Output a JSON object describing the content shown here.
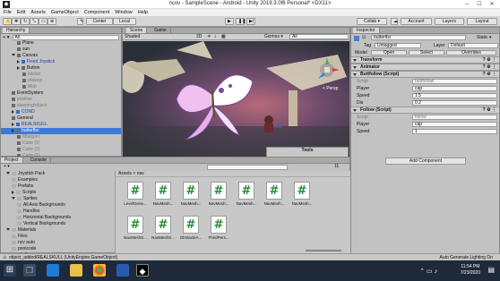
{
  "window": {
    "title": "ncov - SampleScene - Android - Unity 2019.3.0f6 Personal* <DX11>",
    "controls": [
      "─",
      "☐",
      "✕"
    ]
  },
  "menu": [
    "File",
    "Edit",
    "Assets",
    "GameObject",
    "Component",
    "Window",
    "Help"
  ],
  "toolbar": {
    "center": "Center",
    "local": "Local",
    "collab": "Collab ▾",
    "account": "Account",
    "layers": "Layers",
    "layout": "Layout"
  },
  "hierarchy": {
    "title": "Hierarchy",
    "search": "All",
    "items": [
      {
        "label": "Plane",
        "indent": 3,
        "style": "normal"
      },
      {
        "label": "sun",
        "indent": 3,
        "style": "normal"
      },
      {
        "label": "Canvas",
        "indent": 2,
        "style": "normal",
        "arrow": "down"
      },
      {
        "label": "Fixed Joystick",
        "indent": 3,
        "style": "blue",
        "arrow": "right"
      },
      {
        "label": "Button",
        "indent": 3,
        "style": "normal",
        "arrow": "right"
      },
      {
        "label": "blicker",
        "indent": 4,
        "style": "dim"
      },
      {
        "label": "drawcp",
        "indent": 4,
        "style": "dim"
      },
      {
        "label": "Mob",
        "indent": 4,
        "style": "dim"
      },
      {
        "label": "EventSystem",
        "indent": 2,
        "style": "normal"
      },
      {
        "label": "positive",
        "indent": 2,
        "style": "dim"
      },
      {
        "label": "sleeping/object",
        "indent": 2,
        "style": "dim"
      },
      {
        "label": "COND",
        "indent": 2,
        "style": "blue",
        "arrow": "right"
      },
      {
        "label": "General",
        "indent": 2,
        "style": "normal"
      },
      {
        "label": "REALSKULL",
        "indent": 2,
        "style": "blue",
        "arrow": "right"
      },
      {
        "label": "butterfbx",
        "indent": 2,
        "style": "sel",
        "arrow": "right"
      },
      {
        "label": "Mlasport",
        "indent": 3,
        "style": "dim"
      },
      {
        "label": "Cube (1)",
        "indent": 3,
        "style": "dim"
      },
      {
        "label": "Cube (2)",
        "indent": 3,
        "style": "dim"
      },
      {
        "label": "Cube (1)",
        "indent": 3,
        "style": "dim"
      },
      {
        "label": "NU",
        "indent": 2,
        "style": "blue",
        "arrow": "right"
      }
    ]
  },
  "scene": {
    "tabs": [
      "Scene",
      "Game"
    ],
    "shading": "Shaded",
    "mode": "2D",
    "gizmos": "Gizmos ▾",
    "search": "All",
    "persp": "< Persp",
    "tools_title": "Tools",
    "tools_msg": "No custom tools available"
  },
  "inspector": {
    "title": "Inspector",
    "object_name": "butterfbx",
    "static": "Static ▾",
    "tag_label": "Tag",
    "tag": "Untagged",
    "layer_label": "Layer",
    "layer": "Default",
    "model_label": "Model",
    "open": "Open",
    "select": "Select",
    "overrides": "Overrides",
    "components": [
      {
        "name": "Transform",
        "fields": []
      },
      {
        "name": "Animator",
        "fields": []
      },
      {
        "name": "Buttfollow (Script)",
        "fields": [
          {
            "label": "Script",
            "value": "buttfollow"
          },
          {
            "label": "Player",
            "value": "cap"
          },
          {
            "label": "Speed",
            "value": "1.5"
          },
          {
            "label": "Dis",
            "value": "0.2"
          }
        ]
      },
      {
        "name": "Follow (Script)",
        "fields": [
          {
            "label": "Script",
            "value": "follow"
          },
          {
            "label": "Player",
            "value": "cap"
          },
          {
            "label": "Speed",
            "value": "1"
          }
        ]
      }
    ],
    "add_component": "Add Component"
  },
  "project": {
    "tabs": [
      "Project",
      "Console"
    ],
    "breadcrumb": "Assets > nav",
    "count": "11",
    "tree": [
      {
        "label": "Joystick Pack",
        "indent": 1,
        "arrow": "down"
      },
      {
        "label": "Examples",
        "indent": 2
      },
      {
        "label": "Prefabs",
        "indent": 2
      },
      {
        "label": "Scripts",
        "indent": 2,
        "arrow": "right"
      },
      {
        "label": "Sprites",
        "indent": 2,
        "arrow": "down"
      },
      {
        "label": "All Axis Backgrounds",
        "indent": 3
      },
      {
        "label": "Handles",
        "indent": 3
      },
      {
        "label": "Horizontal Backgrounds",
        "indent": 3
      },
      {
        "label": "Vertical Backgrounds",
        "indent": 3
      },
      {
        "label": "Materials",
        "indent": 1,
        "arrow": "down"
      },
      {
        "label": "Files",
        "indent": 2
      },
      {
        "label": "ncv auto",
        "indent": 2
      },
      {
        "label": "poolcode",
        "indent": 2
      },
      {
        "label": "skull",
        "indent": 2
      },
      {
        "label": "nav",
        "indent": 1,
        "style": "sel"
      }
    ],
    "assets": [
      "LevelGene...",
      "NavMesh...",
      "NavMesh...",
      "NavMesh...",
      "NavMesh...",
      "NavMesh...",
      "NavMesh...",
      "NavMeshS...",
      "NavMeshS...",
      "ObstacleA...",
      "ThirdPers..."
    ],
    "status": "object_added/REALSKULL (UnityEngine.GameObject)",
    "status_right": "Auto Generate Lighting On"
  },
  "taskbar": {
    "time": "11:54 PM",
    "date": "7/23/2020"
  }
}
